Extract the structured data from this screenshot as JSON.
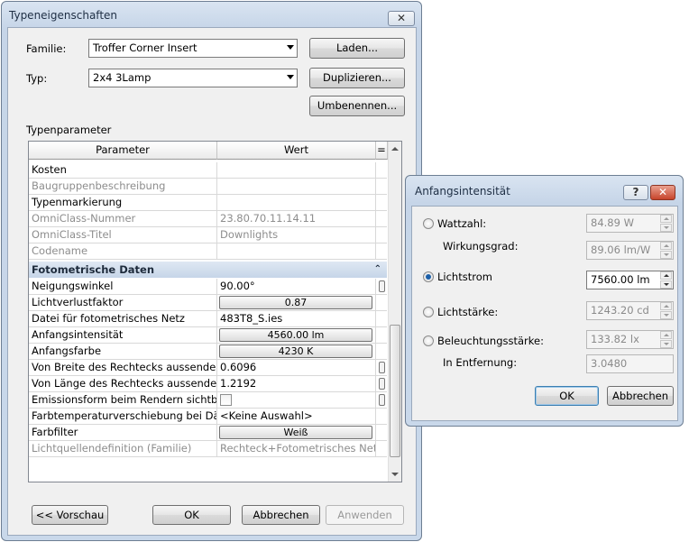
{
  "main_dialog": {
    "title": "Typeneigenschaften",
    "familie_label": "Familie:",
    "familie_value": "Troffer Corner Insert",
    "typ_label": "Typ:",
    "typ_value": "2x4 3Lamp",
    "laden_label": "Laden...",
    "duplizieren_label": "Duplizieren...",
    "umbenennen_label": "Umbenennen...",
    "section_label": "Typenparameter",
    "grid": {
      "col_parameter": "Parameter",
      "col_wert": "Wert",
      "col_eq": "=",
      "rows_top": [
        {
          "p": "Kosten",
          "v": "",
          "gray": false
        },
        {
          "p": "Baugruppenbeschreibung",
          "v": "",
          "gray": true
        },
        {
          "p": "Typenmarkierung",
          "v": "",
          "gray": false
        },
        {
          "p": "OmniClass-Nummer",
          "v": "23.80.70.11.14.11",
          "gray": true
        },
        {
          "p": "OmniClass-Titel",
          "v": "Downlights",
          "gray": true
        },
        {
          "p": "Codename",
          "v": "",
          "gray": true
        }
      ],
      "group_label": "Fotometrische Daten",
      "rows_group": [
        {
          "p": "Neigungswinkel",
          "v": "90.00°",
          "kind": "knob"
        },
        {
          "p": "Lichtverlustfaktor",
          "v": "0.87",
          "kind": "button"
        },
        {
          "p": "Datei für fotometrisches Netz",
          "v": "483T8_S.ies",
          "kind": "text"
        },
        {
          "p": "Anfangsintensität",
          "v": "4560.00 lm",
          "kind": "button"
        },
        {
          "p": "Anfangsfarbe",
          "v": "4230 K",
          "kind": "button"
        },
        {
          "p": "Von Breite des Rechtecks aussenden",
          "v": "0.6096",
          "kind": "knob"
        },
        {
          "p": "Von Länge des Rechtecks aussenden",
          "v": "1.2192",
          "kind": "knob"
        },
        {
          "p": "Emissionsform beim Rendern sichtbar",
          "v": "",
          "kind": "checkbox"
        },
        {
          "p": "Farbtemperaturverschiebung bei Däm",
          "v": "<Keine Auswahl>",
          "kind": "text"
        },
        {
          "p": "Farbfilter",
          "v": "Weiß",
          "kind": "button"
        },
        {
          "p": "Lichtquellendefinition (Familie)",
          "v": "Rechteck+Fotometrisches Netz",
          "kind": "gray"
        }
      ]
    },
    "vorschau_label": "<< Vorschau",
    "ok_label": "OK",
    "abbrechen_label": "Abbrechen",
    "anwenden_label": "Anwenden"
  },
  "sub_dialog": {
    "title": "Anfangsintensität",
    "help_label": "?",
    "wattzahl_label": "Wattzahl:",
    "wattzahl_value": "84.89 W",
    "wirkungsgrad_label": "Wirkungsgrad:",
    "wirkungsgrad_value": "89.06 lm/W",
    "lichtstrom_label": "Lichtstrom",
    "lichtstrom_value": "7560.00 lm",
    "lichtstaerke_label": "Lichtstärke:",
    "lichtstaerke_value": "1243.20 cd",
    "beleuchtung_label": "Beleuchtungsstärke:",
    "beleuchtung_value": "133.82 lx",
    "entfernung_label": "In Entfernung:",
    "entfernung_value": "3.0480",
    "ok_label": "OK",
    "abbrechen_label": "Abbrechen"
  },
  "colors": {
    "group_header": "#c6d5e8",
    "frame": "#c6d5e8",
    "radio_selected": "#1c5fa8"
  }
}
